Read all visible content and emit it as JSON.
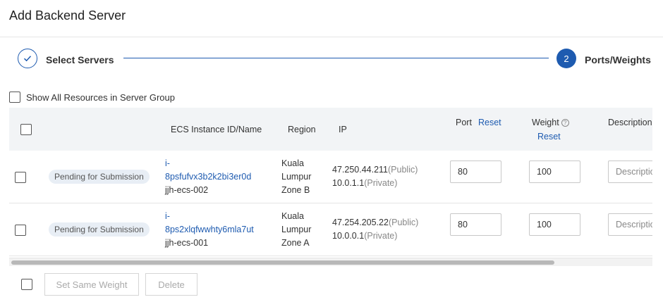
{
  "header": {
    "title": "Add Backend Server"
  },
  "stepper": {
    "step1": {
      "label": "Select Servers"
    },
    "step2": {
      "number": "2",
      "label": "Ports/Weights"
    }
  },
  "options": {
    "show_all_label": "Show All Resources in Server Group"
  },
  "table": {
    "columns": {
      "instance": "ECS Instance ID/Name",
      "region": "Region",
      "ip": "IP",
      "port": "Port",
      "port_reset": "Reset",
      "weight": "Weight",
      "weight_reset": "Reset",
      "description": "Description"
    },
    "rows": [
      {
        "status": "Pending for Submission",
        "id_line1": "i-",
        "id_line2": "8psfufvx3b2k2bi3er0d",
        "name": "jjh-ecs-002",
        "region_line1": "Kuala",
        "region_line2": "Lumpur",
        "region_line3": "Zone B",
        "public_ip": "47.250.44.211",
        "public_tag": "(Public)",
        "private_ip": "10.0.1.1",
        "private_tag": "(Private)",
        "port": "80",
        "weight": "100",
        "description_placeholder": "Description"
      },
      {
        "status": "Pending for Submission",
        "id_line1": "i-",
        "id_line2": "8ps2xlqfwwhty6mla7ut",
        "name": "jjh-ecs-001",
        "region_line1": "Kuala",
        "region_line2": "Lumpur",
        "region_line3": "Zone A",
        "public_ip": "47.254.205.22",
        "public_tag": "(Public)",
        "private_ip": "10.0.0.1",
        "private_tag": "(Private)",
        "port": "80",
        "weight": "100",
        "description_placeholder": "Description"
      }
    ]
  },
  "footer": {
    "set_same_weight_label": "Set Same Weight",
    "delete_label": "Delete"
  },
  "colors": {
    "accent": "#1e5bb0",
    "header_bg": "#f2f4f6",
    "badge_bg": "#e8eef5"
  },
  "icons": {
    "step_done": "check-icon",
    "weight_help": "help-circle-icon"
  }
}
